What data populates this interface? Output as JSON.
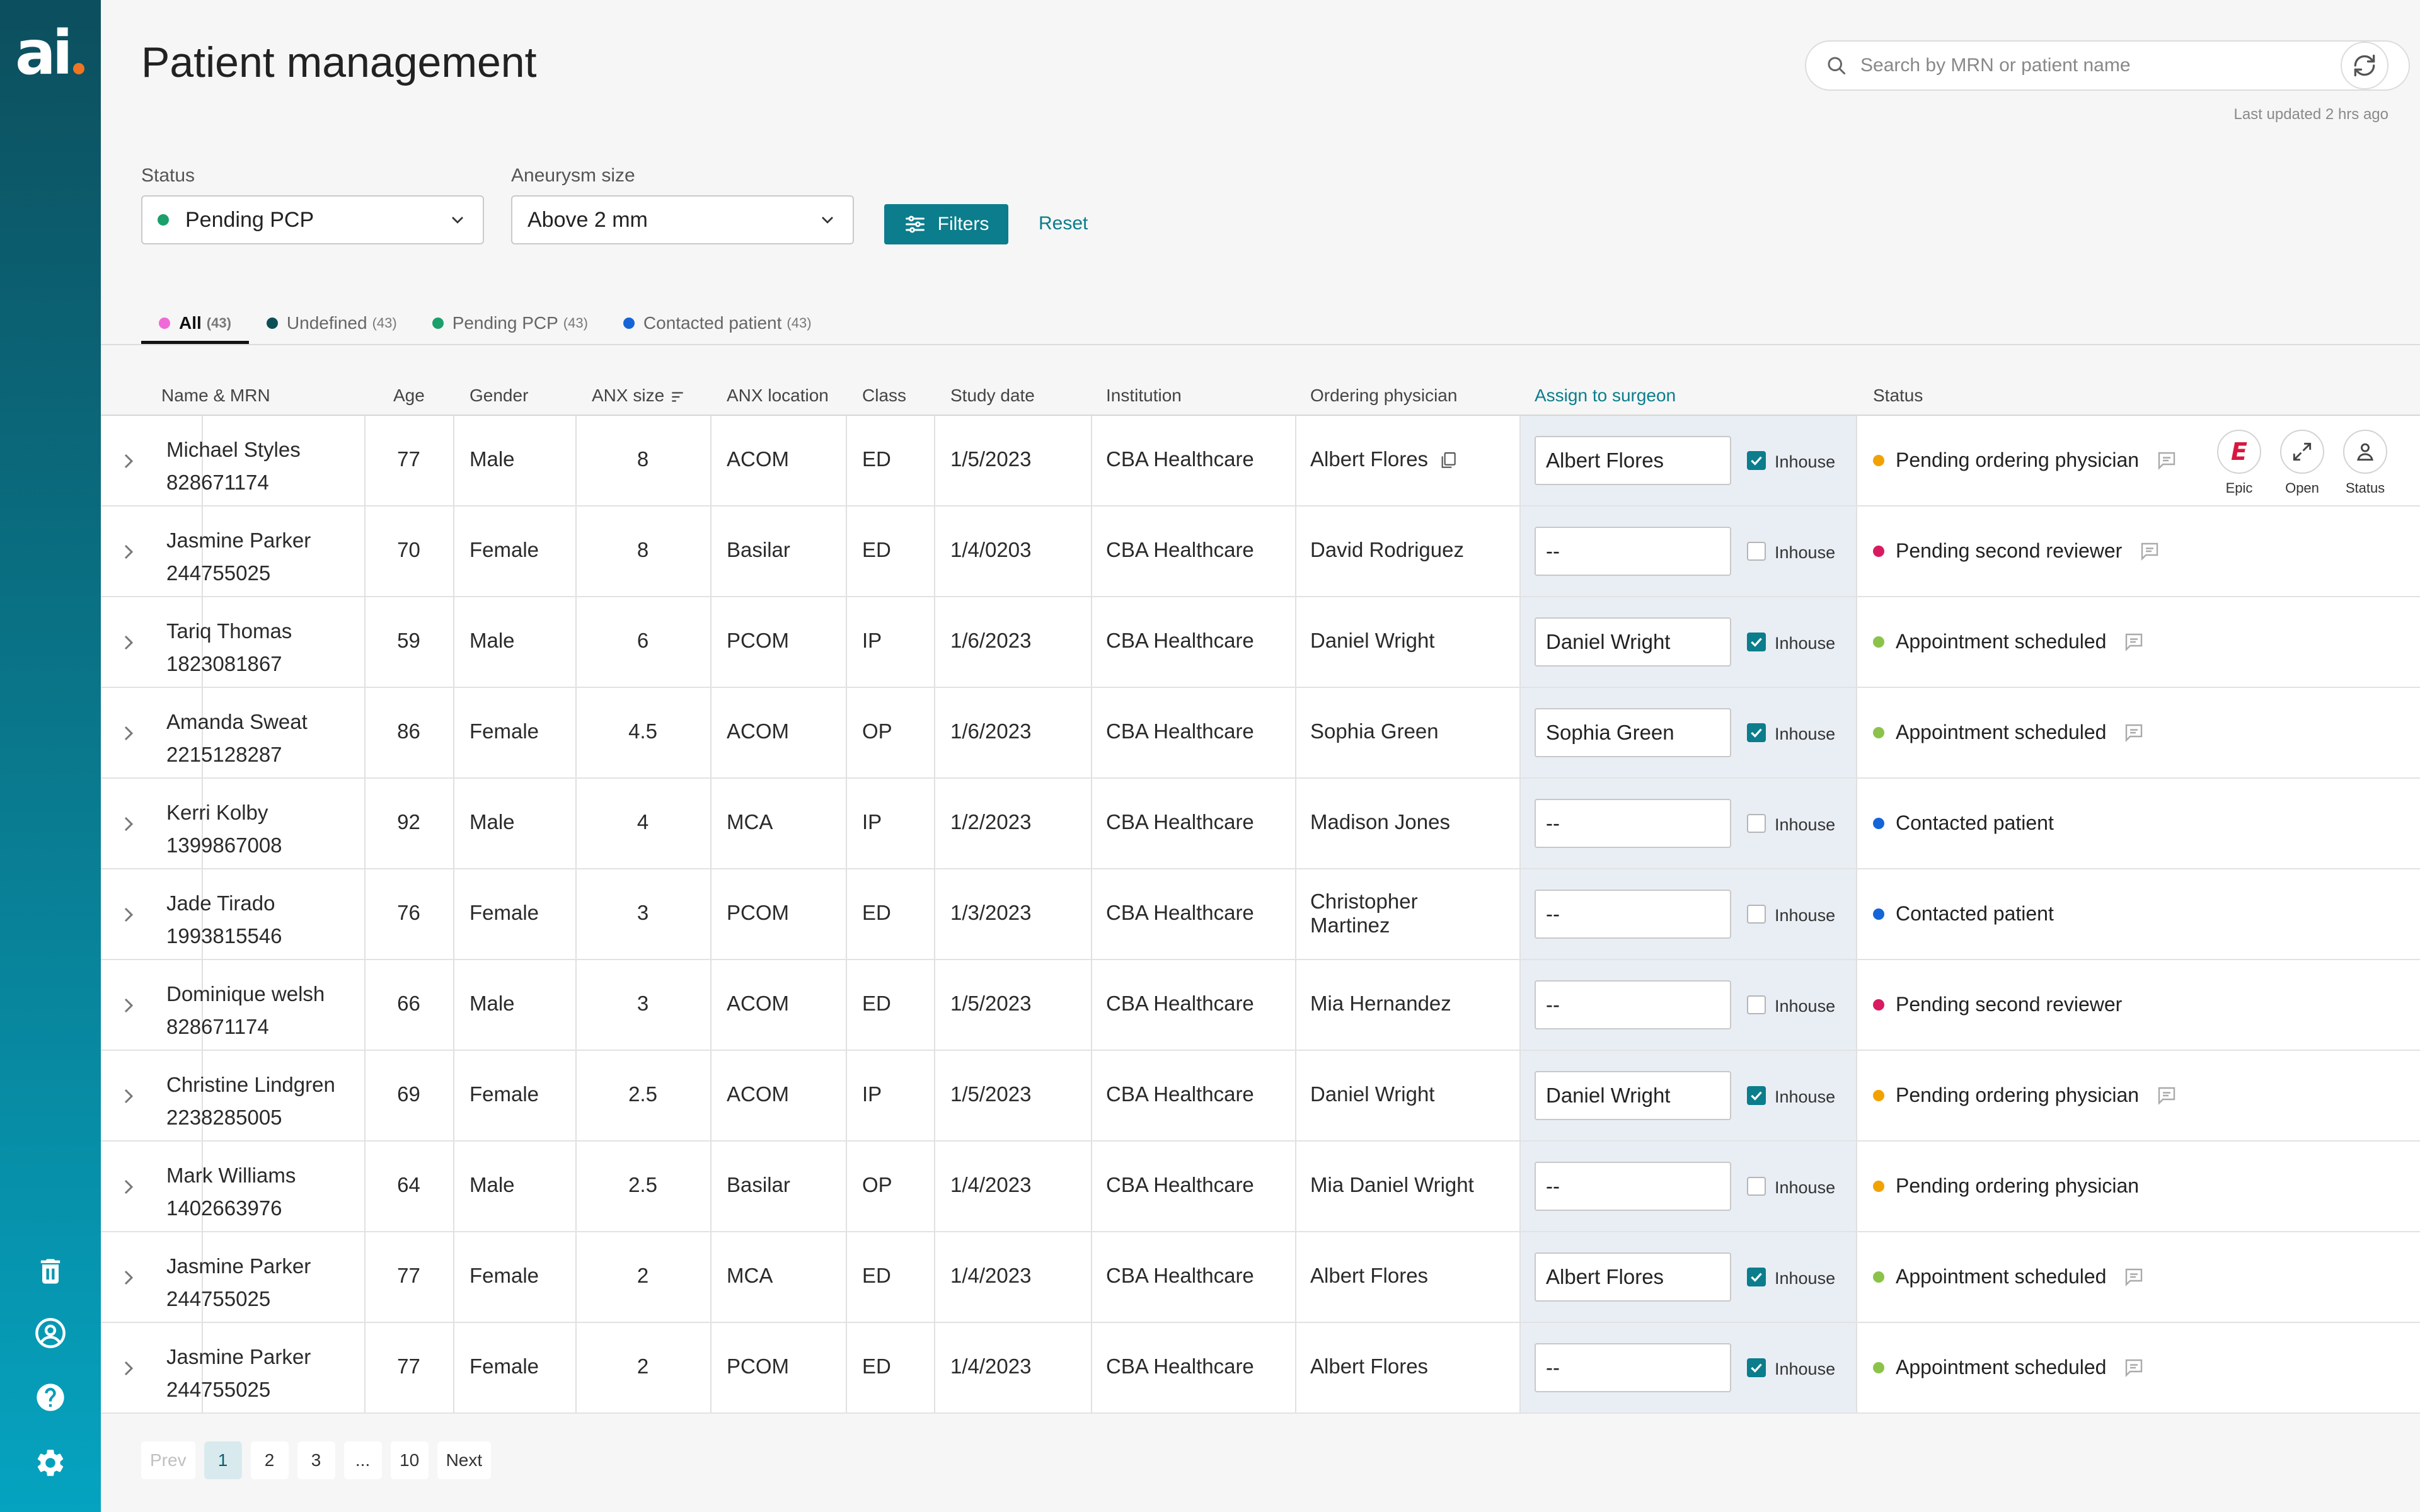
{
  "app": {
    "logo_text": "ai"
  },
  "header": {
    "title": "Patient management",
    "search_placeholder": "Search by MRN or patient name",
    "last_updated": "Last updated 2 hrs ago"
  },
  "filters": {
    "status_label": "Status",
    "status_value": "Pending PCP",
    "aneurysm_label": "Aneurysm size",
    "aneurysm_value": "Above 2 mm",
    "filters_button": "Filters",
    "reset_link": "Reset"
  },
  "tabs": [
    {
      "label": "All",
      "count": "(43)",
      "color": "#f06ad7"
    },
    {
      "label": "Undefined",
      "count": "(43)",
      "color": "#0d4f57"
    },
    {
      "label": "Pending PCP",
      "count": "(43)",
      "color": "#1aa06a"
    },
    {
      "label": "Contacted patient",
      "count": "(43)",
      "color": "#1565d8"
    }
  ],
  "columns": {
    "name_mrn": "Name & MRN",
    "age": "Age",
    "gender": "Gender",
    "anx_size": "ANX size",
    "anx_location": "ANX location",
    "class": "Class",
    "study_date": "Study date",
    "institution": "Institution",
    "ordering_physician": "Ordering physician",
    "assign_surgeon": "Assign to surgeon",
    "status": "Status"
  },
  "inhouse_label": "Inhouse",
  "row_actions": {
    "epic": "Epic",
    "open": "Open",
    "status": "Status"
  },
  "status_colors": {
    "Pending ordering physician": "#f2a200",
    "Pending second reviewer": "#d81b60",
    "Appointment scheduled": "#8bc34a",
    "Contacted patient": "#1565d8"
  },
  "rows": [
    {
      "name": "Michael Styles",
      "mrn": "828671174",
      "age": "77",
      "gender": "Male",
      "anx_size": "8",
      "anx_location": "ACOM",
      "class": "ED",
      "study_date": "1/5/2023",
      "institution": "CBA Healthcare",
      "physician": "Albert Flores",
      "surgeon": "Albert Flores",
      "inhouse": true,
      "status": "Pending ordering physician",
      "note": true
    },
    {
      "name": "Jasmine Parker",
      "mrn": "244755025",
      "age": "70",
      "gender": "Female",
      "anx_size": "8",
      "anx_location": "Basilar",
      "class": "ED",
      "study_date": "1/4/0203",
      "institution": "CBA Healthcare",
      "physician": "David Rodriguez",
      "surgeon": "--",
      "inhouse": false,
      "status": "Pending second reviewer",
      "note": true
    },
    {
      "name": "Tariq Thomas",
      "mrn": "1823081867",
      "age": "59",
      "gender": "Male",
      "anx_size": "6",
      "anx_location": "PCOM",
      "class": "IP",
      "study_date": "1/6/2023",
      "institution": "CBA Healthcare",
      "physician": "Daniel Wright",
      "surgeon": "Daniel Wright",
      "inhouse": true,
      "status": "Appointment scheduled",
      "note": true
    },
    {
      "name": "Amanda Sweat",
      "mrn": "2215128287",
      "age": "86",
      "gender": "Female",
      "anx_size": "4.5",
      "anx_location": "ACOM",
      "class": "OP",
      "study_date": "1/6/2023",
      "institution": "CBA Healthcare",
      "physician": "Sophia Green",
      "surgeon": "Sophia Green",
      "inhouse": true,
      "status": "Appointment scheduled",
      "note": true
    },
    {
      "name": "Kerri Kolby",
      "mrn": "1399867008",
      "age": "92",
      "gender": "Male",
      "anx_size": "4",
      "anx_location": "MCA",
      "class": "IP",
      "study_date": "1/2/2023",
      "institution": "CBA Healthcare",
      "physician": "Madison Jones",
      "surgeon": "--",
      "inhouse": false,
      "status": "Contacted patient",
      "note": false
    },
    {
      "name": "Jade Tirado",
      "mrn": "1993815546",
      "age": "76",
      "gender": "Female",
      "anx_size": "3",
      "anx_location": "PCOM",
      "class": "ED",
      "study_date": "1/3/2023",
      "institution": "CBA Healthcare",
      "physician": "Christopher Martinez",
      "surgeon": "--",
      "inhouse": false,
      "status": "Contacted patient",
      "note": false
    },
    {
      "name": "Dominique welsh",
      "mrn": "828671174",
      "age": "66",
      "gender": "Male",
      "anx_size": "3",
      "anx_location": "ACOM",
      "class": "ED",
      "study_date": "1/5/2023",
      "institution": "CBA Healthcare",
      "physician": "Mia Hernandez",
      "surgeon": "--",
      "inhouse": false,
      "status": "Pending second reviewer",
      "note": false
    },
    {
      "name": "Christine Lindgren",
      "mrn": "2238285005",
      "age": "69",
      "gender": "Female",
      "anx_size": "2.5",
      "anx_location": "ACOM",
      "class": "IP",
      "study_date": "1/5/2023",
      "institution": "CBA Healthcare",
      "physician": "Daniel Wright",
      "surgeon": "Daniel Wright",
      "inhouse": true,
      "status": "Pending ordering physician",
      "note": true
    },
    {
      "name": "Mark Williams",
      "mrn": "1402663976",
      "age": "64",
      "gender": "Male",
      "anx_size": "2.5",
      "anx_location": "Basilar",
      "class": "OP",
      "study_date": "1/4/2023",
      "institution": "CBA Healthcare",
      "physician": "Mia Daniel Wright",
      "surgeon": "--",
      "inhouse": false,
      "status": "Pending ordering physician",
      "note": false
    },
    {
      "name": "Jasmine Parker",
      "mrn": "244755025",
      "age": "77",
      "gender": "Female",
      "anx_size": "2",
      "anx_location": "MCA",
      "class": "ED",
      "study_date": "1/4/2023",
      "institution": "CBA Healthcare",
      "physician": "Albert Flores",
      "surgeon": "Albert Flores",
      "inhouse": true,
      "status": "Appointment scheduled",
      "note": true
    },
    {
      "name": "Jasmine Parker",
      "mrn": "244755025",
      "age": "77",
      "gender": "Female",
      "anx_size": "2",
      "anx_location": "PCOM",
      "class": "ED",
      "study_date": "1/4/2023",
      "institution": "CBA Healthcare",
      "physician": "Albert Flores",
      "surgeon": "--",
      "inhouse": true,
      "status": "Appointment scheduled",
      "note": true
    }
  ],
  "pagination": {
    "prev": "Prev",
    "pages": [
      "1",
      "2",
      "3",
      "...",
      "10"
    ],
    "active": "1",
    "next": "Next"
  }
}
